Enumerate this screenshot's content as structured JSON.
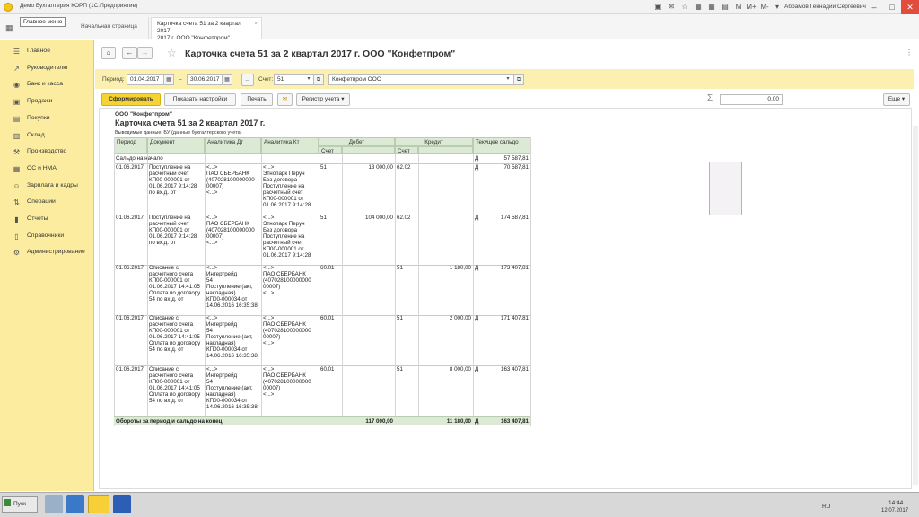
{
  "window": {
    "title": "Демо Бухгалтерия КОРП (1С:Предприятие)",
    "user": "Абрамов Геннадий Сергеевич",
    "toolbar_icons": [
      "M",
      "M+",
      "M-"
    ]
  },
  "tabs": {
    "main_menu_tip": "Главное меню",
    "home": "Начальная страница",
    "card_line1": "Карточка счета 51 за 2 квартал 2017",
    "card_line2": "2017 г. ООО \"Конфетпром\""
  },
  "sidebar": {
    "items": [
      {
        "label": "Главное",
        "icon": "list-icon"
      },
      {
        "label": "Руководителю",
        "icon": "chart-icon"
      },
      {
        "label": "Банк и касса",
        "icon": "bank-icon"
      },
      {
        "label": "Продажи",
        "icon": "sales-icon"
      },
      {
        "label": "Покупки",
        "icon": "cart-icon"
      },
      {
        "label": "Склад",
        "icon": "warehouse-icon"
      },
      {
        "label": "Производство",
        "icon": "factory-icon"
      },
      {
        "label": "ОС и НМА",
        "icon": "assets-icon"
      },
      {
        "label": "Зарплата и кадры",
        "icon": "people-icon"
      },
      {
        "label": "Операции",
        "icon": "operations-icon"
      },
      {
        "label": "Отчеты",
        "icon": "reports-icon"
      },
      {
        "label": "Справочники",
        "icon": "book-icon"
      },
      {
        "label": "Администрирование",
        "icon": "gear-icon"
      }
    ]
  },
  "form": {
    "title": "Карточка счета 51 за 2 квартал 2017 г. ООО \"Конфетпром\"",
    "period_label": "Период:",
    "period_from": "01.04.2017",
    "period_dash": "–",
    "period_to": "30.06.2017",
    "period_btn": "...",
    "account_label": "Счет:",
    "account_value": "51",
    "org_value": "Конфетпром ООО",
    "btn_form": "Сформировать",
    "btn_settings": "Показать настройки",
    "btn_print": "Печать",
    "btn_register": "Регистр учета",
    "sum_value": "0,00",
    "sigma": "Σ",
    "btn_more": "Еще"
  },
  "report": {
    "org": "ООО \"Конфетпром\"",
    "title": "Карточка счета 51 за 2 квартал 2017 г.",
    "output": "Выводимые данные:  БУ (данные бухгалтерского учета)",
    "headers": {
      "period": "Период",
      "document": "Документ",
      "analytics_dt": "Аналитика Дт",
      "analytics_kt": "Аналитика Кт",
      "debit": "Дебет",
      "credit": "Кредит",
      "balance": "Текущее сальдо",
      "account": "Счет"
    },
    "opening": {
      "label": "Сальдо на начало",
      "side": "Д",
      "value": "57 587,81"
    },
    "rows": [
      {
        "date": "01.06.2017",
        "doc": "Поступление на\nрасчетный счет\nКП00-000001 от\n01.06.2017 9:14:28\n по вх.д.  от",
        "dt": "<...>\nПАО СБЕРБАНК\n(407028100000000\n00007)\n<...>",
        "kt": "<...>\nЭтнопарк Перун\nБез договора\nПоступление на\nрасчетный счет\nКП00-000001 от\n01.06.2017 9:14:28",
        "dacc": "51",
        "dsum": "13 000,00",
        "cacc": "62.02",
        "csum": "",
        "side": "Д",
        "bal": "70 587,81"
      },
      {
        "date": "01.06.2017",
        "doc": "Поступление на\nрасчетный счет\nКП00-000001 от\n01.06.2017 9:14:28\n по вх.д.  от",
        "dt": "<...>\nПАО СБЕРБАНК\n(407028100000000\n00007)\n<...>",
        "kt": "<...>\nЭтнопарк Перун\nБез договора\nПоступление на\nрасчетный счет\nКП00-000001 от\n01.06.2017 9:14:28",
        "dacc": "51",
        "dsum": "104 000,00",
        "cacc": "62.02",
        "csum": "",
        "side": "Д",
        "bal": "174 587,81"
      },
      {
        "date": "01.06.2017",
        "doc": "Списание с\nрасчетного счета\nКП00-000001 от\n01.06.2017 14:41:05\nОплата по договору\n54 по вх.д.  от",
        "dt": "<...>\nИнтертрейд\n54\nПоступление (акт,\nнакладная)\nКП00-000034 от\n14.06.2016 16:35:38",
        "kt": "<...>\nПАО СБЕРБАНК\n(407028100000000\n00007)\n<...>",
        "dacc": "60.01",
        "dsum": "",
        "cacc": "51",
        "csum": "1 180,00",
        "side": "Д",
        "bal": "173 407,81"
      },
      {
        "date": "01.06.2017",
        "doc": "Списание с\nрасчетного счета\nКП00-000001 от\n01.06.2017 14:41:05\nОплата по договору\n54 по вх.д.  от",
        "dt": "<...>\nИнтертрейд\n54\nПоступление (акт,\nнакладная)\nКП00-000034 от\n14.06.2016 16:35:38",
        "kt": "<...>\nПАО СБЕРБАНК\n(407028100000000\n00007)\n<...>",
        "dacc": "60.01",
        "dsum": "",
        "cacc": "51",
        "csum": "2 000,00",
        "side": "Д",
        "bal": "171 407,81"
      },
      {
        "date": "01.06.2017",
        "doc": "Списание с\nрасчетного счета\nКП00-000001 от\n01.06.2017 14:41:05\nОплата по договору\n54 по вх.д.  от",
        "dt": "<...>\nИнтертрейд\n54\nПоступление (акт,\nнакладная)\nКП00-000034 от\n14.06.2016 16:35:38",
        "kt": "<...>\nПАО СБЕРБАНК\n(407028100000000\n00007)\n<...>",
        "dacc": "60.01",
        "dsum": "",
        "cacc": "51",
        "csum": "8 000,00",
        "side": "Д",
        "bal": "163 407,81"
      }
    ],
    "total": {
      "label": "Обороты за период и сальдо на конец",
      "debit": "117 000,00",
      "credit": "11 180,00",
      "side": "Д",
      "balance": "163 407,81"
    }
  },
  "taskbar": {
    "start": "Пуск",
    "lang": "RU",
    "time": "14:44",
    "date": "12.07.2017"
  }
}
